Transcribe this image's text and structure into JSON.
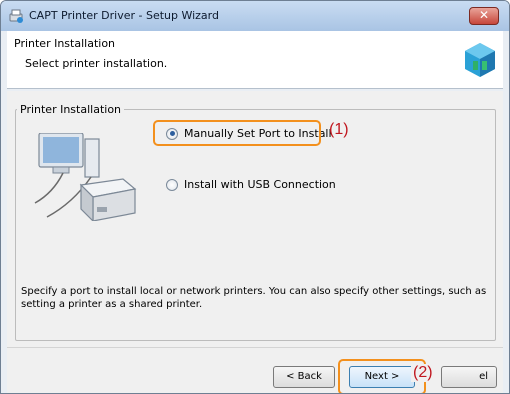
{
  "window": {
    "title": "CAPT Printer Driver - Setup Wizard",
    "close_label": "✕"
  },
  "header": {
    "title": "Printer Installation",
    "subtitle": "Select printer installation."
  },
  "group": {
    "title": "Printer Installation"
  },
  "options": {
    "manual_label": "Manually Set Port to Install",
    "manual_checked": true,
    "usb_label": "Install with USB Connection",
    "usb_checked": false
  },
  "description": "Specify a port to install local or network printers. You can also specify other settings, such as setting a printer as a shared printer.",
  "buttons": {
    "back_label": "< Back",
    "next_label": "Next >",
    "cancel_label": "el"
  },
  "callouts": {
    "one": "(1)",
    "two": "(2)"
  },
  "colors": {
    "highlight": "#f3901d",
    "callout_text": "#c0171f"
  }
}
